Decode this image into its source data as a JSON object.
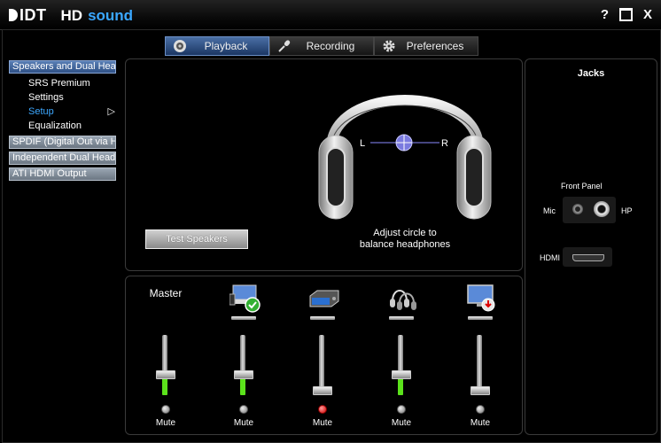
{
  "app": {
    "logo_brand": "IDT",
    "logo_product_hd": "HD",
    "logo_product_sound": "sound",
    "help_label": "?",
    "close_label": "X"
  },
  "tabs": [
    {
      "label": "Playback",
      "icon": "speaker-icon",
      "active": true
    },
    {
      "label": "Recording",
      "icon": "microphone-icon",
      "active": false
    },
    {
      "label": "Preferences",
      "icon": "gear-icon",
      "active": false
    }
  ],
  "sidebar": {
    "devices": [
      {
        "label": "Speakers and Dual Headphones",
        "selected": true
      },
      {
        "label": "SPDIF (Digital Out via HP)",
        "selected": false
      },
      {
        "label": "Independent Dual Headphones",
        "selected": false
      },
      {
        "label": "ATI HDMI Output",
        "selected": false
      }
    ],
    "sub_items": [
      {
        "label": "SRS Premium",
        "active": false
      },
      {
        "label": "Settings",
        "active": false
      },
      {
        "label": "Setup",
        "active": true,
        "arrow": "▷"
      },
      {
        "label": "Equalization",
        "active": false
      }
    ]
  },
  "main": {
    "test_button": "Test Speakers",
    "balance_left": "L",
    "balance_right": "R",
    "balance_line1": "Adjust circle to",
    "balance_line2": "balance headphones"
  },
  "jacks": {
    "title": "Jacks",
    "front_panel_label": "Front Panel",
    "mic_label": "Mic",
    "hp_label": "HP",
    "hdmi_label": "HDMI"
  },
  "mixer": {
    "mute_label": "Mute",
    "channels": [
      {
        "label": "Master",
        "icon": "",
        "level": 0.32,
        "muted": false
      },
      {
        "label": "",
        "icon": "speakers-laptop-icon",
        "level": 0.32,
        "muted": false
      },
      {
        "label": "",
        "icon": "spdif-device-icon",
        "level": 0.05,
        "muted": true
      },
      {
        "label": "",
        "icon": "dual-headphones-icon",
        "level": 0.32,
        "muted": false
      },
      {
        "label": "",
        "icon": "hdmi-monitor-icon",
        "level": 0.05,
        "muted": false
      }
    ]
  },
  "colors": {
    "accent": "#3da8ff",
    "level_fill": "#5be21b",
    "mute_active": "#d00000"
  }
}
